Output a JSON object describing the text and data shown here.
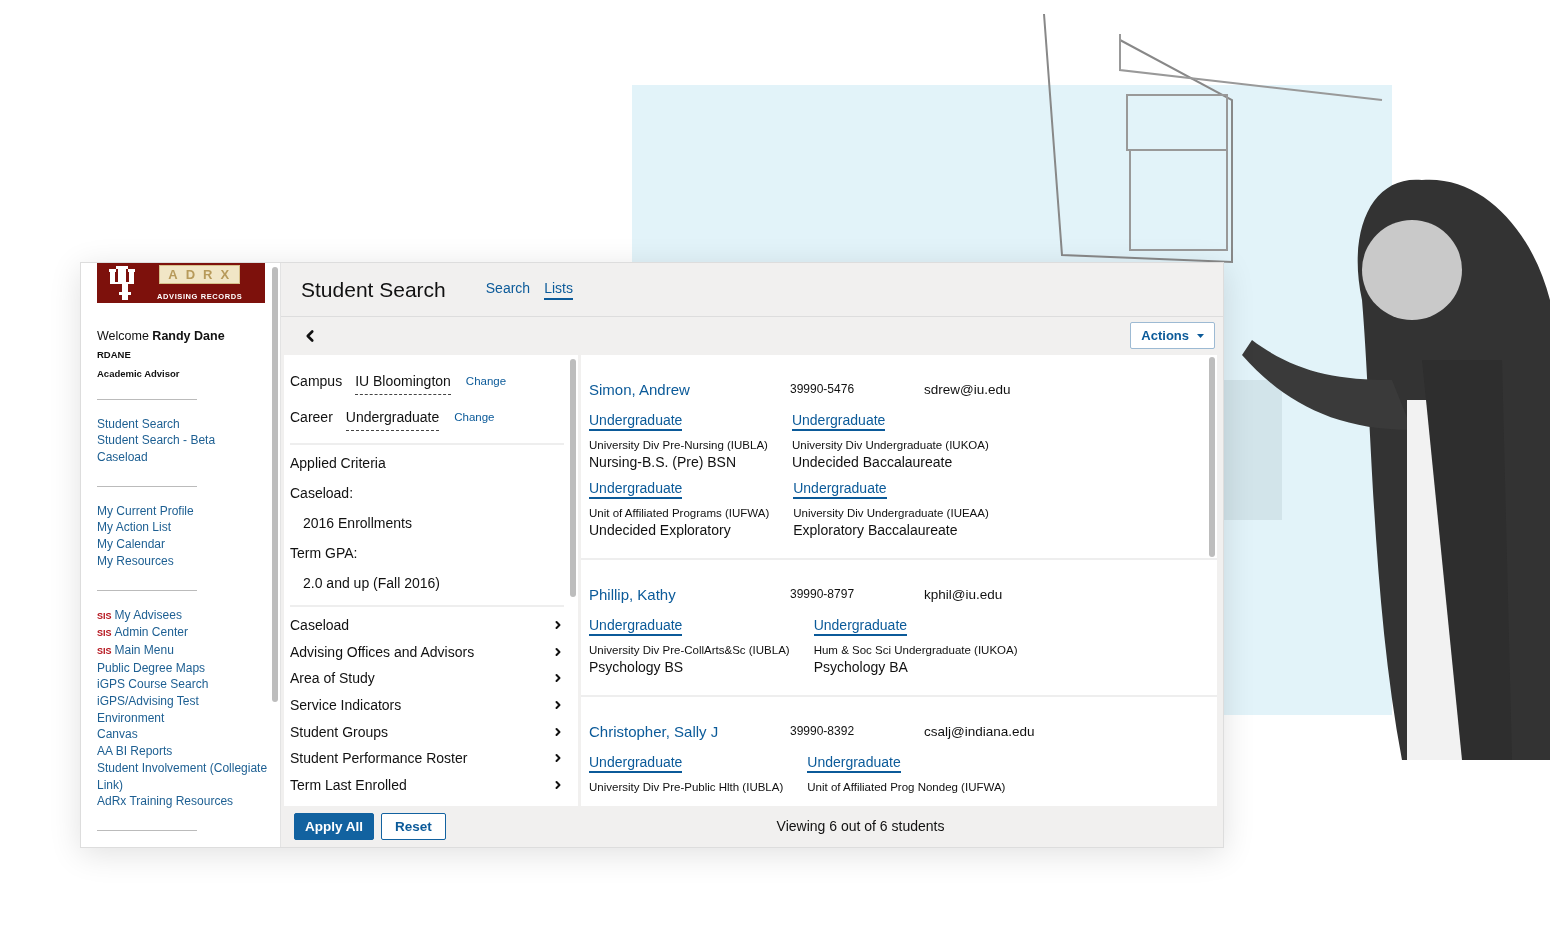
{
  "sidebar": {
    "logo": {
      "wordmark": "ADRX",
      "subtitle": "ADVISING RECORDS"
    },
    "welcome": {
      "greeting": "Welcome",
      "name": "Randy Dane"
    },
    "username": "RDANE",
    "role": "Academic Advisor",
    "link_groups": [
      [
        {
          "label": "Student Search"
        },
        {
          "label": "Student Search - Beta"
        },
        {
          "label": "Caseload"
        }
      ],
      [
        {
          "label": "My Current Profile"
        },
        {
          "label": "My Action List"
        },
        {
          "label": "My Calendar"
        },
        {
          "label": "My Resources"
        }
      ],
      [
        {
          "badge": "SIS",
          "label": "My Advisees"
        },
        {
          "badge": "SIS",
          "label": "Admin Center"
        },
        {
          "badge": "SIS",
          "label": "Main Menu"
        },
        {
          "label": "Public Degree Maps"
        },
        {
          "label": "iGPS Course Search"
        },
        {
          "label": "iGPS/Advising Test Environment"
        },
        {
          "label": "Canvas"
        },
        {
          "label": "AA BI Reports"
        },
        {
          "label": "Student Involvement (Collegiate Link)"
        },
        {
          "label": "AdRx Training Resources"
        }
      ]
    ]
  },
  "header": {
    "title": "Student Search",
    "tabs": [
      {
        "label": "Search",
        "selected": false
      },
      {
        "label": "Lists",
        "selected": true
      }
    ]
  },
  "toolbar": {
    "actions": "Actions"
  },
  "filters": {
    "fields": [
      {
        "label": "Campus",
        "value": "IU Bloomington",
        "action": "Change"
      },
      {
        "label": "Career",
        "value": "Undergraduate",
        "action": "Change"
      }
    ],
    "applied_title": "Applied Criteria",
    "criteria": [
      {
        "label": "Caseload:",
        "value": "2016 Enrollments"
      },
      {
        "label": "Term GPA:",
        "value": "2.0 and up (Fall 2016)"
      }
    ],
    "categories": [
      "Caseload",
      "Advising Offices and Advisors",
      "Area of Study",
      "Service Indicators",
      "Student Groups",
      "Student Performance Roster",
      "Term Last Enrolled"
    ]
  },
  "buttons": {
    "apply": "Apply All",
    "reset": "Reset"
  },
  "students": [
    {
      "name": "Simon, Andrew",
      "id": "39990-5476",
      "email": "sdrew@iu.edu",
      "program_rows": [
        [
          {
            "career": "Undergraduate",
            "org": "University Div Pre-Nursing (IUBLA)",
            "plan": "Nursing-B.S. (Pre) BSN"
          },
          {
            "career": "Undergraduate",
            "org": "University Div Undergraduate (IUKOA)",
            "plan": "Undecided Baccalaureate"
          }
        ],
        [
          {
            "career": "Undergraduate",
            "org": "Unit of Affiliated Programs (IUFWA)",
            "plan": "Undecided Exploratory"
          },
          {
            "career": "Undergraduate",
            "org": "University Div Undergraduate (IUEAA)",
            "plan": "Exploratory Baccalaureate"
          }
        ]
      ]
    },
    {
      "name": "Phillip, Kathy",
      "id": "39990-8797",
      "email": "kphil@iu.edu",
      "program_rows": [
        [
          {
            "career": "Undergraduate",
            "org": "University Div Pre-CollArts&Sc (IUBLA)",
            "plan": "Psychology BS"
          },
          {
            "career": "Undergraduate",
            "org": "Hum & Soc Sci Undergraduate (IUKOA)",
            "plan": "Psychology BA"
          }
        ]
      ]
    },
    {
      "name": "Christopher, Sally J",
      "id": "39990-8392",
      "email": "csalj@indiana.edu",
      "program_rows": [
        [
          {
            "career": "Undergraduate",
            "org": "University Div Pre-Public Hlth (IUBLA)"
          },
          {
            "career": "Undergraduate",
            "org": "Unit of Affiliated Prog Nondeg (IUFWA)"
          }
        ]
      ]
    }
  ],
  "status": "Viewing 6 out of 6 students"
}
